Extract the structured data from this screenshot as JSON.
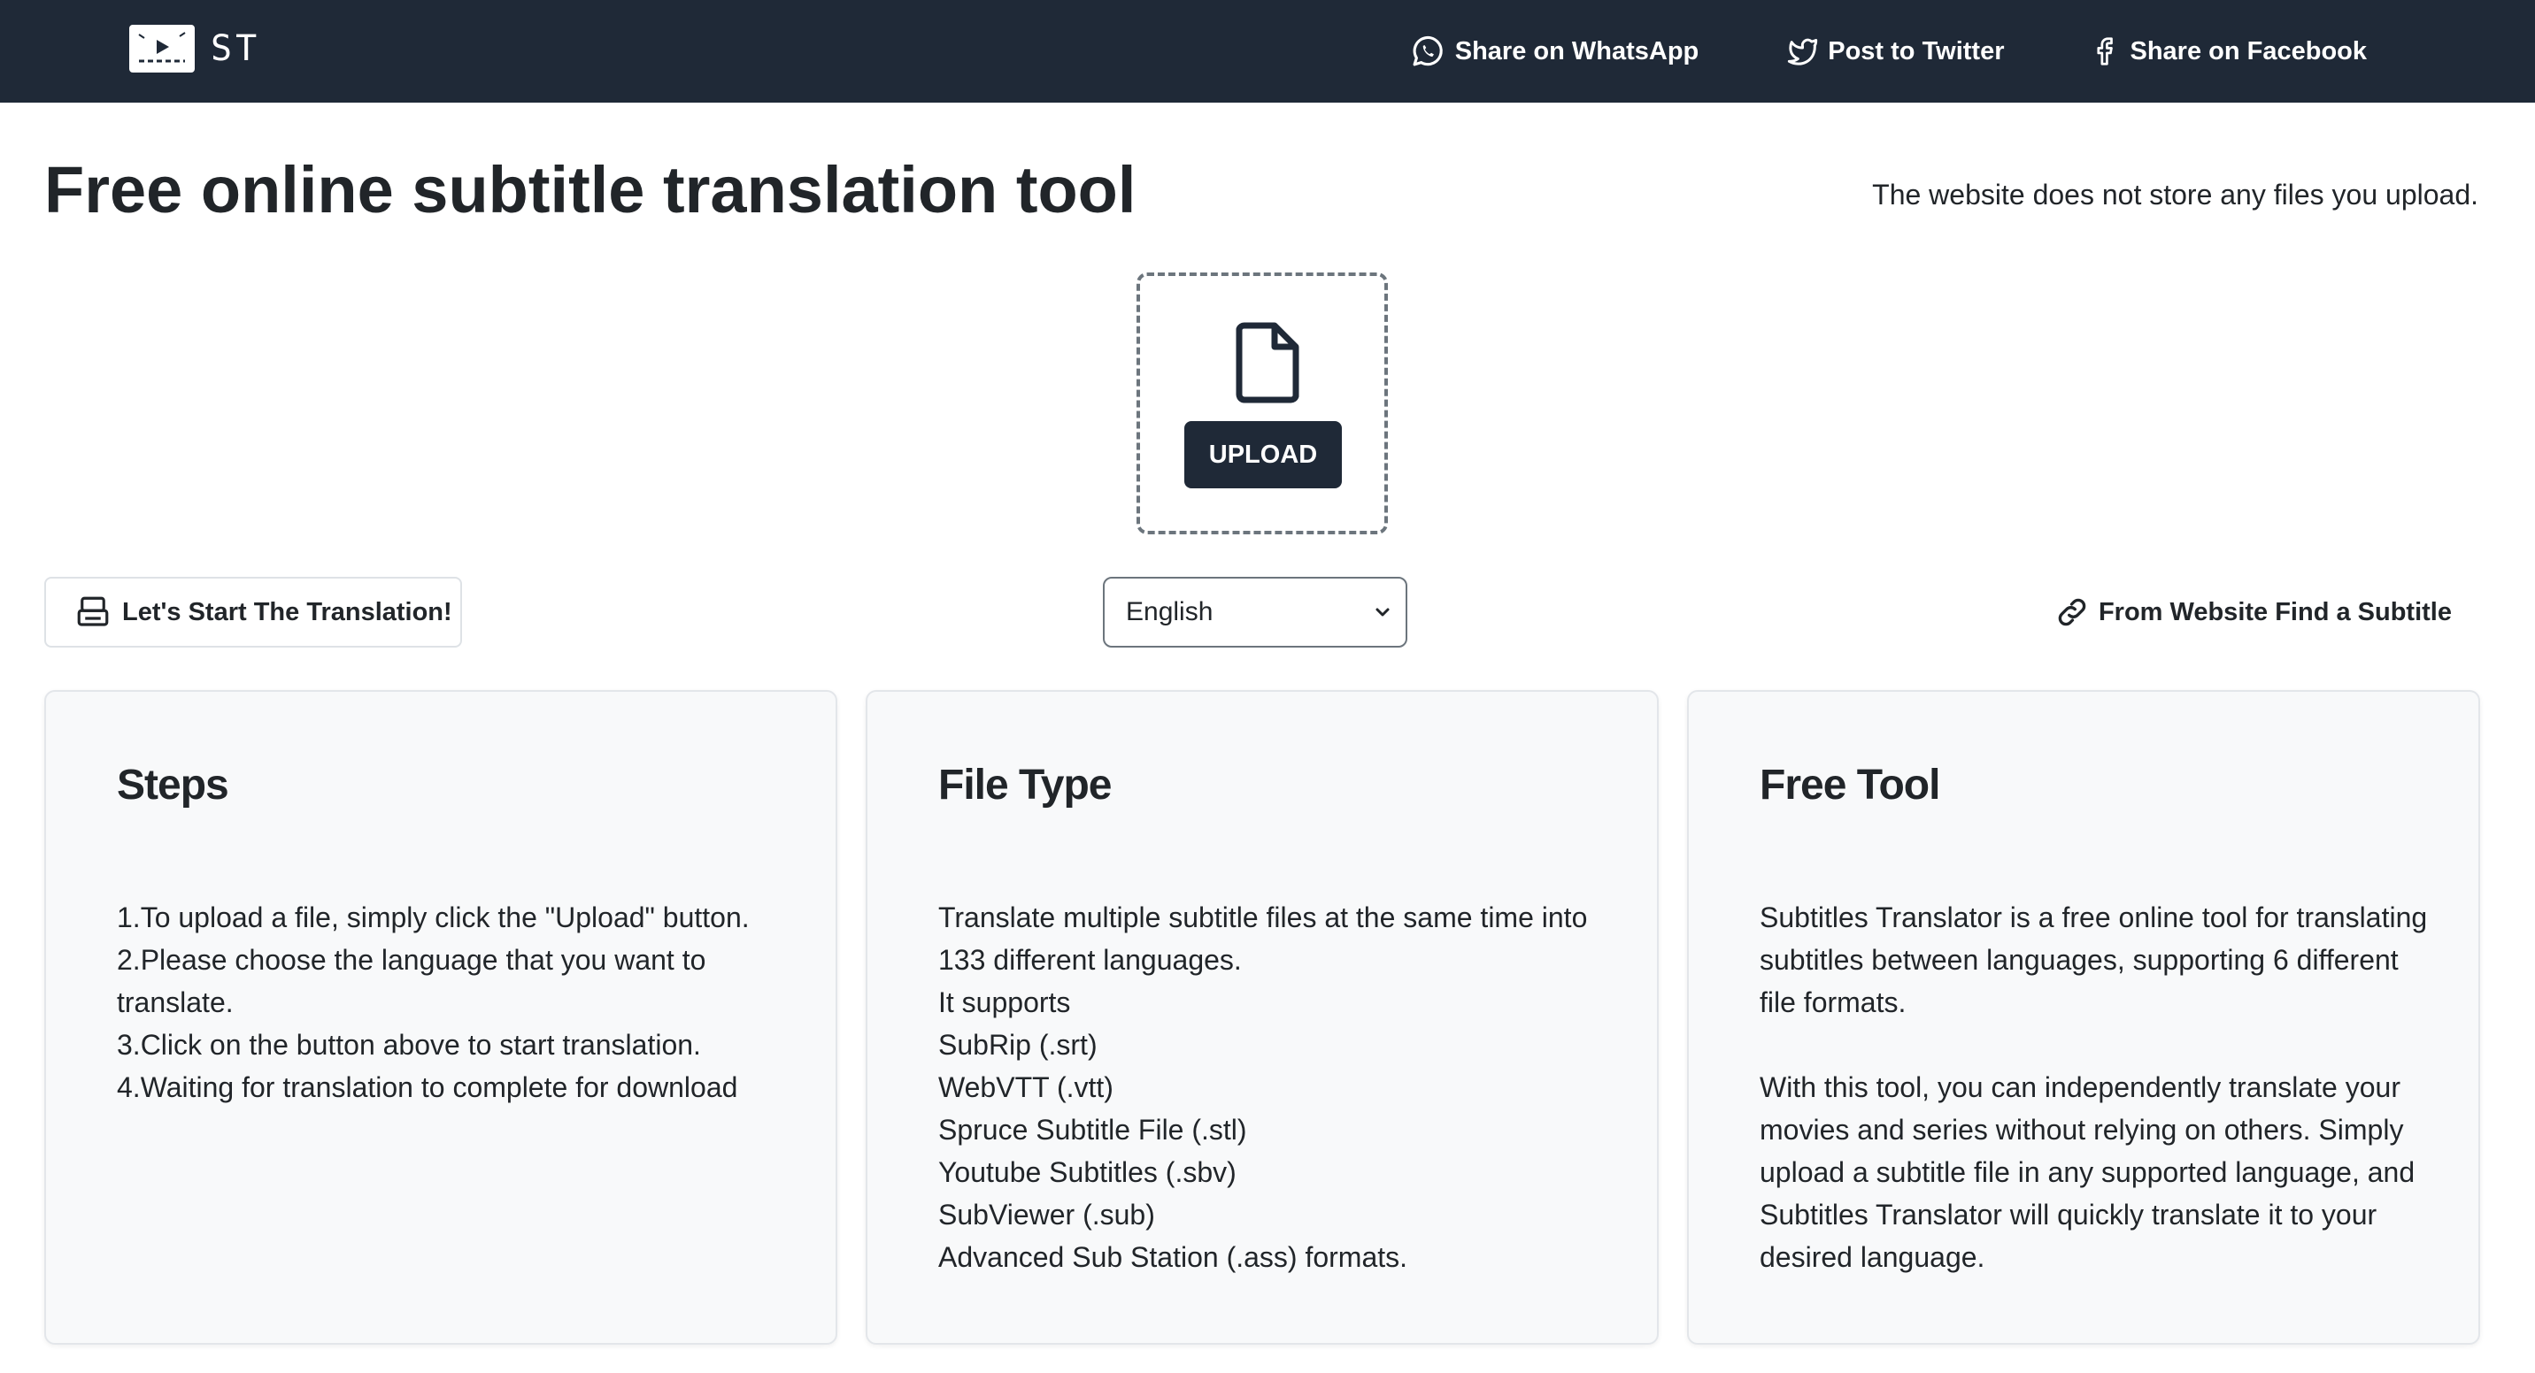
{
  "nav": {
    "logo_text": "ST",
    "links": [
      {
        "label": "Share on WhatsApp",
        "icon": "whatsapp-icon"
      },
      {
        "label": "Post to Twitter",
        "icon": "twitter-icon"
      },
      {
        "label": "Share on Facebook",
        "icon": "facebook-icon"
      }
    ]
  },
  "header": {
    "title": "Free online subtitle translation tool",
    "privacy_note": "The website does not store any files you upload."
  },
  "upload": {
    "icon": "file-icon",
    "button_label": "UPLOAD"
  },
  "controls": {
    "start_label": "Let's Start The Translation!",
    "language_selected": "English",
    "find_label": "From Website Find a Subtitle"
  },
  "cards": [
    {
      "title": "Steps",
      "body": "1.To upload a file, simply click the \"Upload\" button.\n2.Please choose the language that you want to translate.\n3.Click on the button above to start translation.\n4.Waiting for translation to complete for download"
    },
    {
      "title": "File Type",
      "body": "Translate multiple subtitle files at the same time into 133 different languages.\nIt supports\nSubRip (.srt)\nWebVTT (.vtt)\nSpruce Subtitle File (.stl)\nYoutube Subtitles (.sbv)\nSubViewer (.sub)\nAdvanced Sub Station (.ass) formats."
    },
    {
      "title": "Free Tool",
      "body": "Subtitles Translator is a free online tool for translating subtitles between languages, supporting 6 different file formats.\n\nWith this tool, you can independently translate your movies and series without relying on others. Simply upload a subtitle file in any supported language, and Subtitles Translator will quickly translate it to your desired language."
    }
  ],
  "colors": {
    "navbar_bg": "#1f2937",
    "button_dark": "#1f2937",
    "card_bg": "#f8f9fa",
    "text": "#212529"
  }
}
